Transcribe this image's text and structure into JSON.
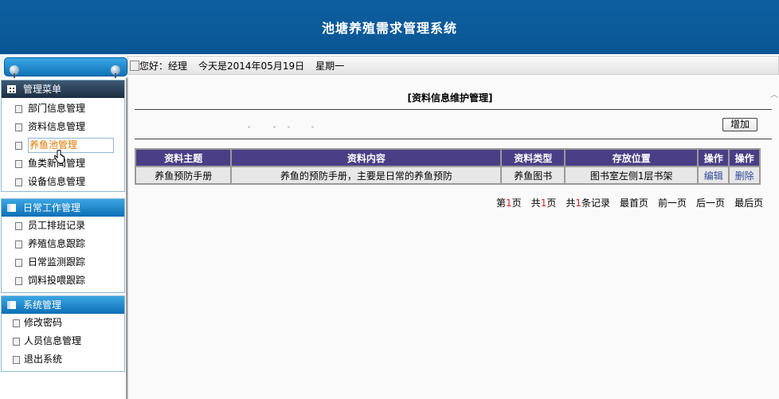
{
  "header": {
    "title": "池塘养殖需求管理系统"
  },
  "greeting": {
    "hello": "您好：经理",
    "date_text": "今天是2014年05月19日",
    "weekday": "星期一"
  },
  "sidebar": {
    "sections": [
      {
        "title": "管理菜单",
        "items": [
          "部门信息管理",
          "资料信息管理",
          "养鱼池管理",
          "鱼类新闻管理",
          "设备信息管理"
        ]
      },
      {
        "title": "日常工作管理",
        "items": [
          "员工排班记录",
          "养殖信息跟踪",
          "日常监测跟踪",
          "饲料投喂跟踪"
        ]
      },
      {
        "title": "系统管理",
        "items": [
          "修改密码",
          "人员信息管理",
          "退出系统"
        ]
      }
    ]
  },
  "main": {
    "panel_title": "[资料信息维护管理]",
    "add_label": "增加",
    "table": {
      "headers": [
        "资料主题",
        "资料内容",
        "资料类型",
        "存放位置",
        "操作",
        "操作"
      ],
      "rows": [
        {
          "topic": "养鱼预防手册",
          "content": "养鱼的预防手册，主要是日常的养鱼预防",
          "type": "养鱼图书",
          "location": "图书室左侧1层书架",
          "edit": "编辑",
          "delete": "删除"
        }
      ]
    },
    "pager": {
      "page_prefix": "第",
      "page_num": "1",
      "page_suffix": "页",
      "total_prefix": "共",
      "total_pages": "1",
      "total_suffix": "页",
      "records_prefix": "共",
      "records": "1",
      "records_suffix": "条记录",
      "first": "最首页",
      "prev": "前一页",
      "next": "后一页",
      "last": "最后页"
    }
  },
  "colors": {
    "header_bg": "#0a5694",
    "table_header_bg": "#4a3f86",
    "link": "#2f4a9c",
    "active_item": "#e07a00"
  }
}
